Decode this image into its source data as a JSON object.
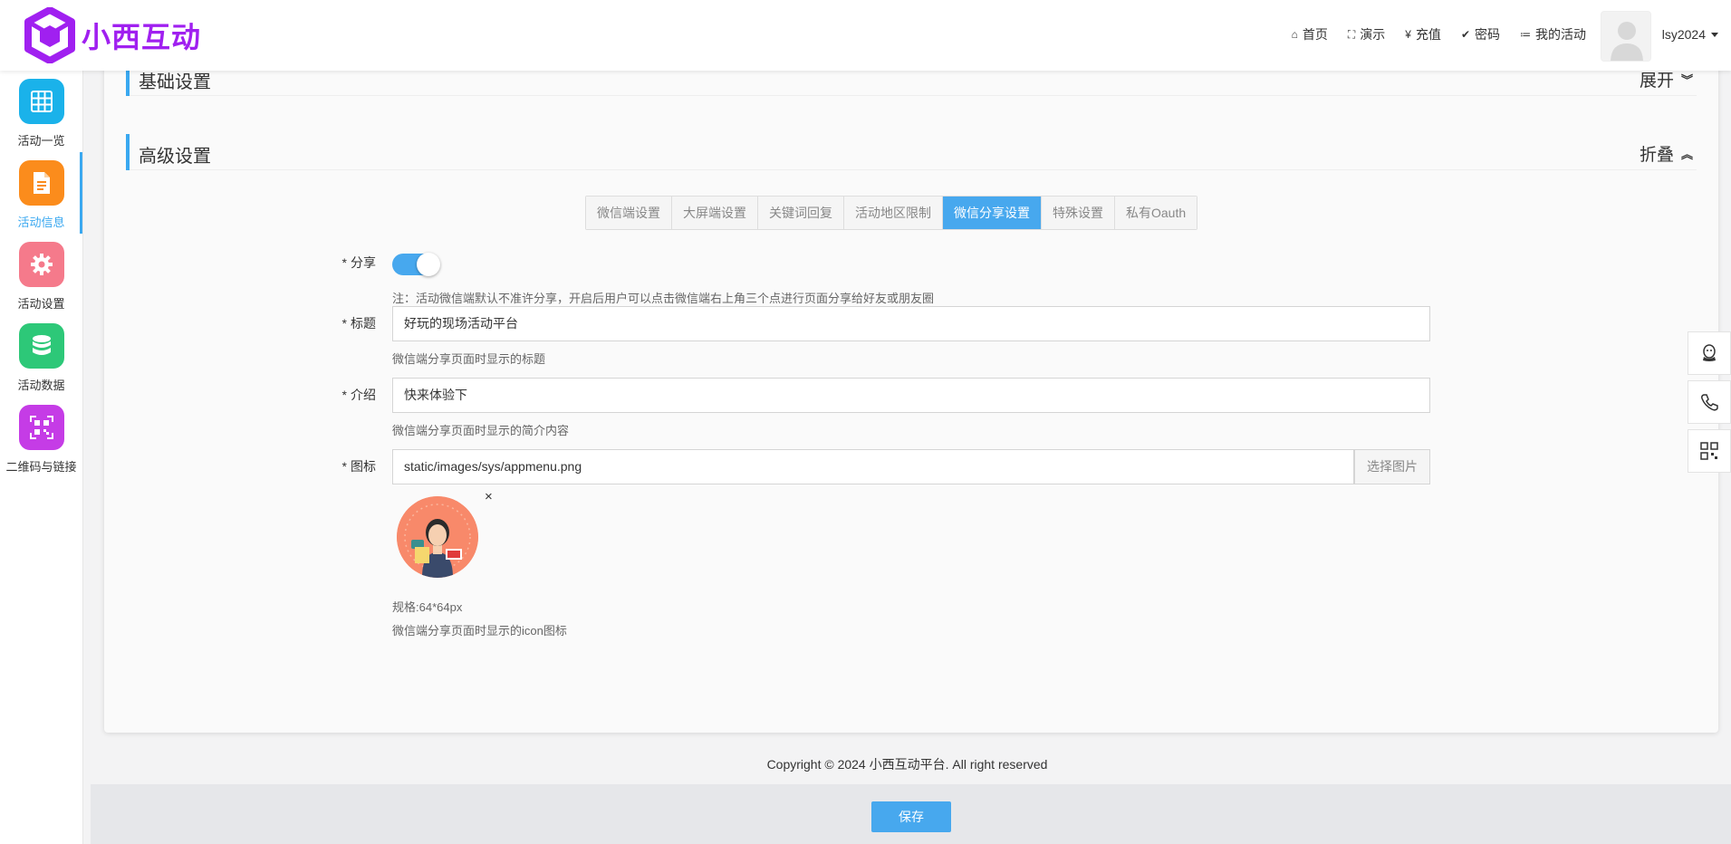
{
  "brand": {
    "name": "小西互动"
  },
  "topnav": [
    {
      "icon": "home-icon",
      "glyph": "⌂",
      "label": "首页"
    },
    {
      "icon": "fullscreen-icon",
      "glyph": "⛶",
      "label": "演示"
    },
    {
      "icon": "yen-icon",
      "glyph": "¥",
      "label": "充值"
    },
    {
      "icon": "check-circle-icon",
      "glyph": "✔",
      "label": "密码"
    },
    {
      "icon": "list-icon",
      "glyph": "≔",
      "label": "我的活动"
    }
  ],
  "user": {
    "name": "lsy2024"
  },
  "sidebar": [
    {
      "label": "活动一览",
      "color": "#1ab2ea",
      "icon": "grid-icon",
      "active": false
    },
    {
      "label": "活动信息",
      "color": "#fb8c1c",
      "icon": "document-icon",
      "active": true
    },
    {
      "label": "活动设置",
      "color": "#f57a8b",
      "icon": "gear-icon",
      "active": false
    },
    {
      "label": "活动数据",
      "color": "#2dc878",
      "icon": "database-icon",
      "active": false
    },
    {
      "label": "二维码与链接",
      "color": "#c53ce6",
      "icon": "qrcode-icon",
      "active": false
    }
  ],
  "sections": {
    "basic": {
      "title": "基础设置",
      "toggle": "展开",
      "chevron": "⌄⌄"
    },
    "advanced": {
      "title": "高级设置",
      "toggle": "折叠",
      "chevron": "⌃⌃"
    }
  },
  "tabs": [
    {
      "label": "微信端设置",
      "active": false
    },
    {
      "label": "大屏端设置",
      "active": false
    },
    {
      "label": "关键词回复",
      "active": false
    },
    {
      "label": "活动地区限制",
      "active": false
    },
    {
      "label": "微信分享设置",
      "active": true
    },
    {
      "label": "特殊设置",
      "active": false
    },
    {
      "label": "私有Oauth",
      "active": false
    }
  ],
  "form": {
    "share": {
      "label": "分享",
      "enabled": true,
      "note": "注：活动微信端默认不准许分享，开启后用户可以点击微信端右上角三个点进行页面分享给好友或朋友圈"
    },
    "title": {
      "label": "标题",
      "value": "好玩的现场活动平台",
      "hint": "微信端分享页面时显示的标题"
    },
    "intro": {
      "label": "介绍",
      "value": "快来体验下",
      "hint": "微信端分享页面时显示的简介内容"
    },
    "icon": {
      "label": "图标",
      "value": "static/images/sys/appmenu.png",
      "button": "选择图片",
      "spec": "规格:64*64px",
      "hint": "微信端分享页面时显示的icon图标",
      "remove": "×"
    }
  },
  "footer": {
    "copyright": "Copyright © 2024 小西互动平台. All right reserved"
  },
  "actions": {
    "save": "保存"
  },
  "float_tools": [
    "qq-icon",
    "phone-icon",
    "qrcode-icon"
  ]
}
